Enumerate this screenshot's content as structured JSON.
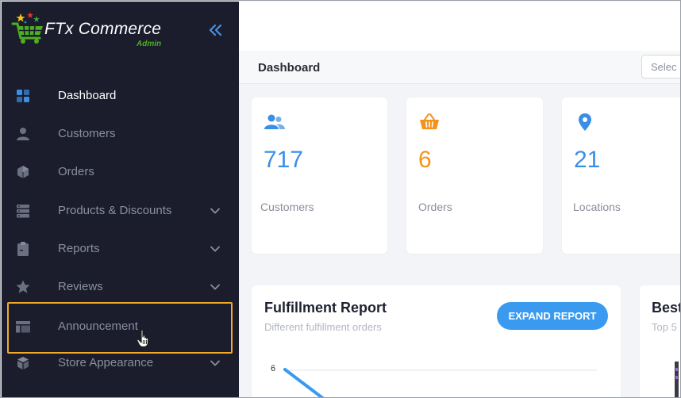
{
  "sidebar": {
    "logo": {
      "name": "FTx Commerce",
      "sub": "Admin"
    },
    "collapse_icon": "double-chevron-left-icon",
    "items": [
      {
        "label": "Dashboard",
        "icon": "grid-icon",
        "active": true,
        "expandable": false
      },
      {
        "label": "Customers",
        "icon": "person-icon",
        "active": false,
        "expandable": false
      },
      {
        "label": "Orders",
        "icon": "box-icon",
        "active": false,
        "expandable": false
      },
      {
        "label": "Products & Discounts",
        "icon": "stack-icon",
        "active": false,
        "expandable": true
      },
      {
        "label": "Reports",
        "icon": "clipboard-icon",
        "active": false,
        "expandable": true
      },
      {
        "label": "Reviews",
        "icon": "star-icon",
        "active": false,
        "expandable": true
      },
      {
        "label": "Announcement",
        "icon": "layout-icon",
        "active": false,
        "expandable": false
      },
      {
        "label": "Store Appearance",
        "icon": "cube-icon",
        "active": false,
        "expandable": true
      }
    ]
  },
  "header": {
    "page_title": "Dashboard",
    "select_placeholder": "Selec"
  },
  "stats": [
    {
      "value": "717",
      "label": "Customers",
      "icon": "users-icon",
      "color": "#3a8ee6"
    },
    {
      "value": "6",
      "label": "Orders",
      "icon": "basket-icon",
      "color": "#f3931c"
    },
    {
      "value": "21",
      "label": "Locations",
      "icon": "map-pin-icon",
      "color": "#3a8ee6"
    }
  ],
  "fulfillment": {
    "title": "Fulfillment Report",
    "subtitle": "Different fulfillment orders",
    "button": "EXPAND REPORT",
    "chart_y_label": "6"
  },
  "best": {
    "title": "Best",
    "subtitle": "Top 5"
  },
  "colors": {
    "sidebar_bg": "#1b1d2c",
    "accent": "#3a9af0",
    "highlight": "#f0a92a",
    "logo_green": "#4caf22"
  }
}
